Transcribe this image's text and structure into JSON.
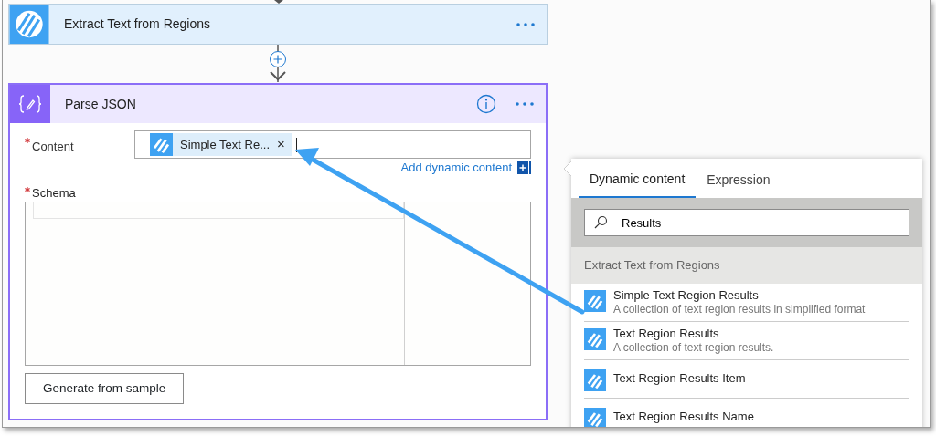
{
  "extract_step": {
    "title": "Extract Text from Regions"
  },
  "parse_step": {
    "title": "Parse JSON",
    "content_field": {
      "label": "Content",
      "required": true,
      "token": {
        "label": "Simple Text Re...",
        "remove": "×"
      }
    },
    "add_dynamic_link": "Add dynamic content",
    "schema_field": {
      "label": "Schema",
      "required": true
    },
    "button": "Generate from sample"
  },
  "dynamic_panel": {
    "tabs": [
      {
        "label": "Dynamic content",
        "selected": true
      },
      {
        "label": "Expression",
        "selected": false
      }
    ],
    "search": {
      "value": "Results"
    },
    "group": {
      "title": "Extract Text from Regions",
      "items": [
        {
          "title": "Simple Text Region Results",
          "description": "A collection of text region results in simplified format"
        },
        {
          "title": "Text Region Results",
          "description": "A collection of text region results."
        },
        {
          "title": "Text Region Results Item"
        },
        {
          "title": "Text Region Results Name"
        }
      ]
    }
  }
}
